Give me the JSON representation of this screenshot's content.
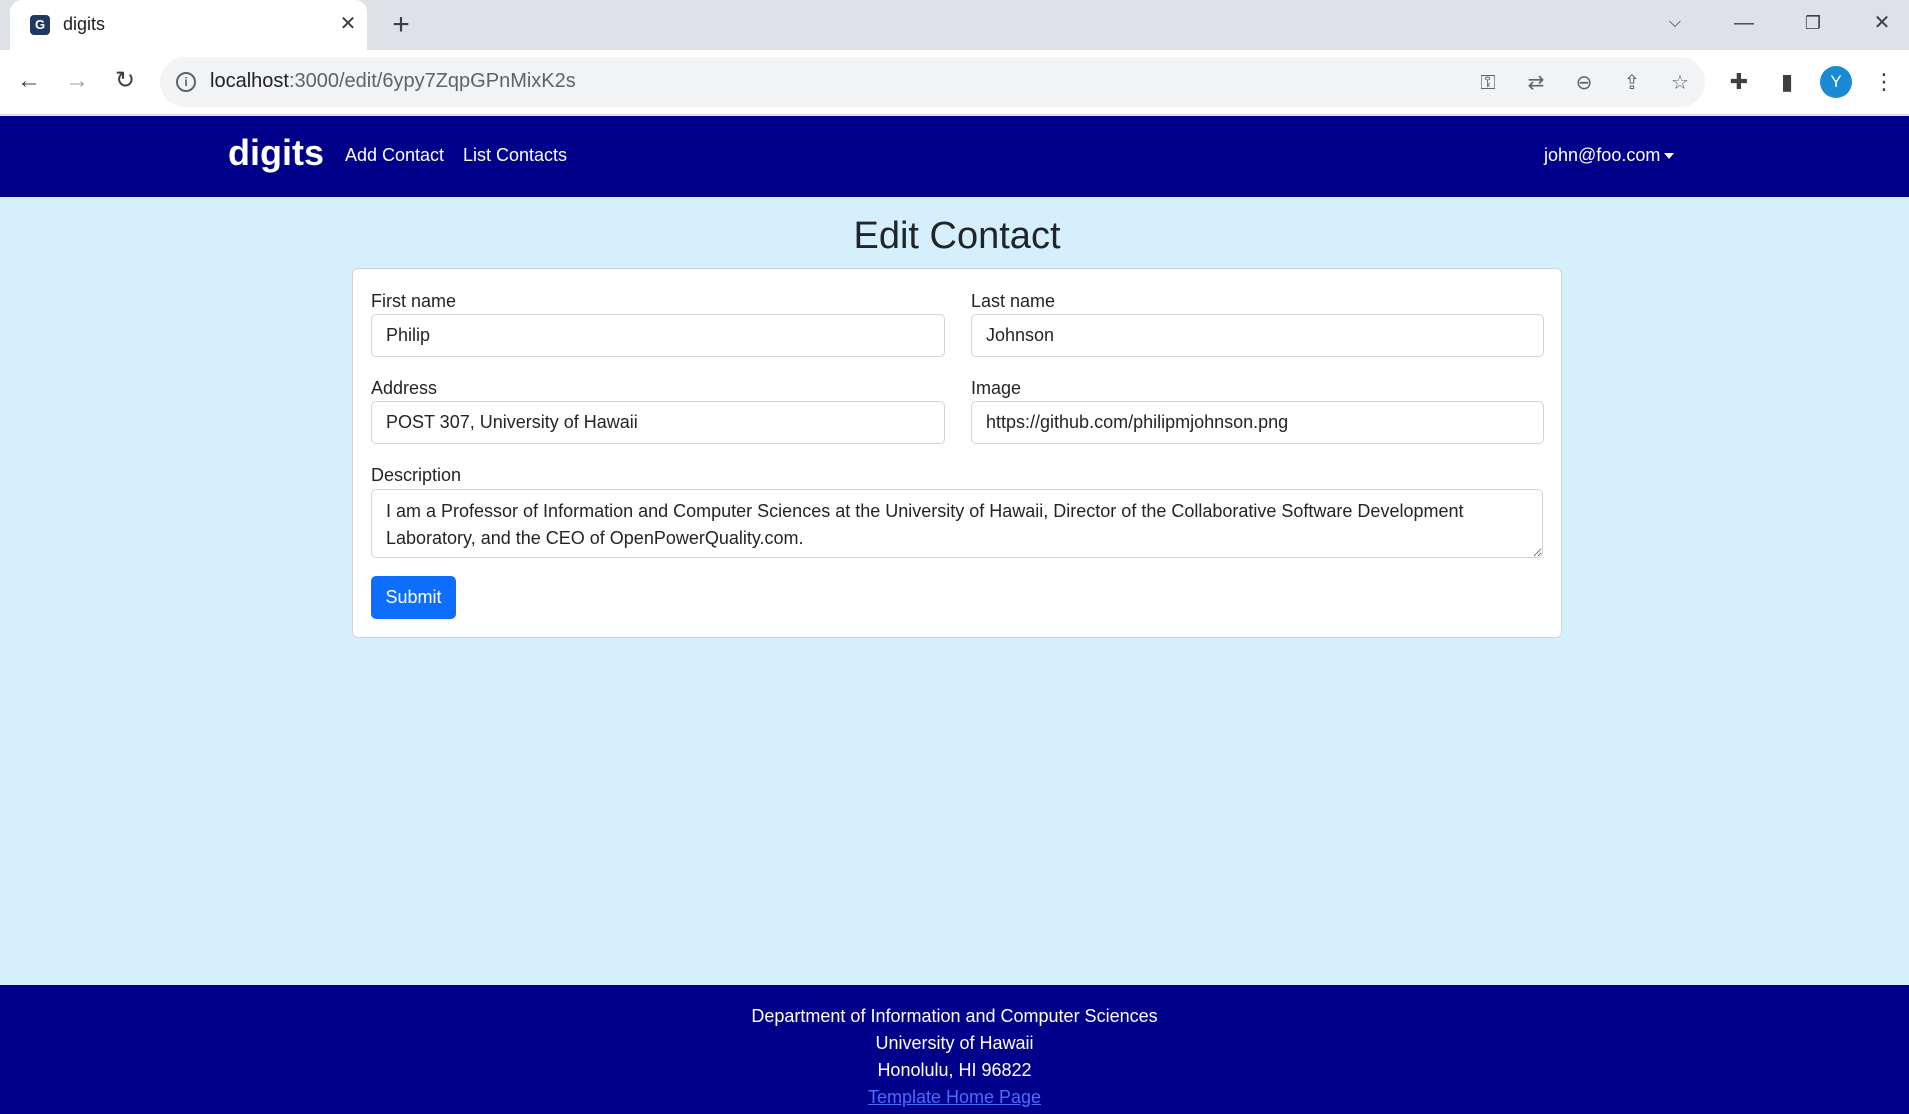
{
  "browser": {
    "tab_title": "digits",
    "favicon_letter": "G",
    "url_host": "localhost",
    "url_path": ":3000/edit/6ypy7ZqpGPnMixK2s",
    "profile_initial": "Y",
    "icons": [
      "back-icon",
      "forward-icon",
      "reload-icon",
      "info-icon",
      "key-icon",
      "translate-icon",
      "zoom-out-icon",
      "share-icon",
      "star-icon",
      "extensions-icon",
      "sidepanel-icon",
      "menu-icon"
    ]
  },
  "navbar": {
    "brand": "digits",
    "links": [
      "Add Contact",
      "List Contacts"
    ],
    "user": "john@foo.com",
    "background": "#00008b"
  },
  "page": {
    "title": "Edit Contact",
    "background": "#d5f0fc"
  },
  "form": {
    "first_name": {
      "label": "First name",
      "value": "Philip"
    },
    "last_name": {
      "label": "Last name",
      "value": "Johnson"
    },
    "address": {
      "label": "Address",
      "value": "POST 307, University of Hawaii"
    },
    "image": {
      "label": "Image",
      "value": "https://github.com/philipmjohnson.png"
    },
    "description": {
      "label": "Description",
      "value": "I am a Professor of Information and Computer Sciences at the University of Hawaii, Director of the Collaborative Software Development Laboratory, and the CEO of OpenPowerQuality.com."
    },
    "submit_label": "Submit",
    "submit_color": "#0d6efd"
  },
  "footer": {
    "lines": [
      "Department of Information and Computer Sciences",
      "University of Hawaii",
      "Honolulu, HI 96822"
    ],
    "link": "Template Home Page"
  }
}
